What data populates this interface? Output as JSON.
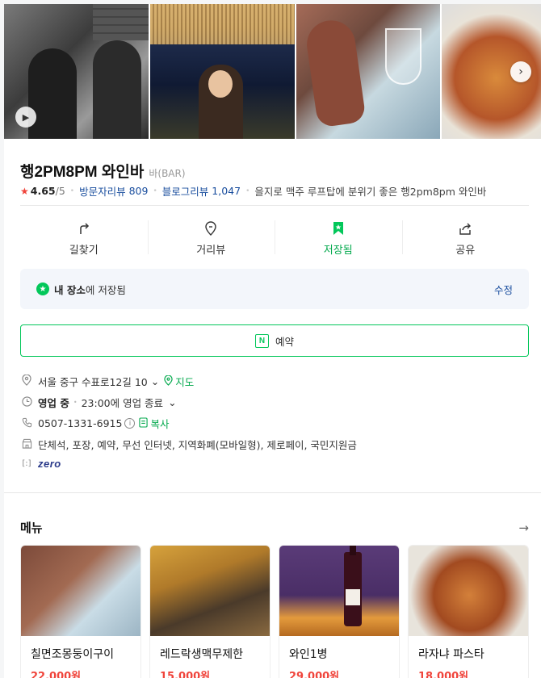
{
  "place": {
    "name": "행2PM8PM 와인바",
    "category": "바(BAR)",
    "rating": "4.65",
    "rating_max": "/5",
    "visitor_review_label": "방문자리뷰",
    "visitor_review_count": "809",
    "blog_review_label": "블로그리뷰",
    "blog_review_count": "1,047",
    "description": "을지로 맥주 루프탑에 분위기 좋은 행2pm8pm 와인바"
  },
  "actions": [
    {
      "label": "길찾기",
      "icon": "directions-icon"
    },
    {
      "label": "거리뷰",
      "icon": "location-pin-icon"
    },
    {
      "label": "저장됨",
      "icon": "bookmark-icon"
    },
    {
      "label": "공유",
      "icon": "share-icon"
    }
  ],
  "saved": {
    "place_label": "내 장소",
    "text": "에 저장됨",
    "edit_label": "수정"
  },
  "reserve_label": "예약",
  "info": {
    "address": "서울 중구 수표로12길 10",
    "map_label": "지도",
    "status": "영업 중",
    "hours": "23:00에 영업 종료",
    "phone": "0507-1331-6915",
    "copy_label": "복사",
    "amenities": "단체석, 포장, 예약, 무선 인터넷, 지역화폐(모바일형), 제로페이, 국민지원금",
    "zero_label": "zero"
  },
  "menu": {
    "title": "메뉴",
    "items": [
      {
        "name": "칠면조몽둥이구이",
        "price": "22,000원"
      },
      {
        "name": "레드락생맥무제한",
        "price": "15,000원"
      },
      {
        "name": "와인1병",
        "price": "29,000원"
      },
      {
        "name": "라자냐 파스타",
        "price": "18,000원"
      }
    ]
  },
  "colors": {
    "brand_green": "#03c75a",
    "link_blue": "#1a4e9e",
    "price_red": "#f0443b"
  }
}
